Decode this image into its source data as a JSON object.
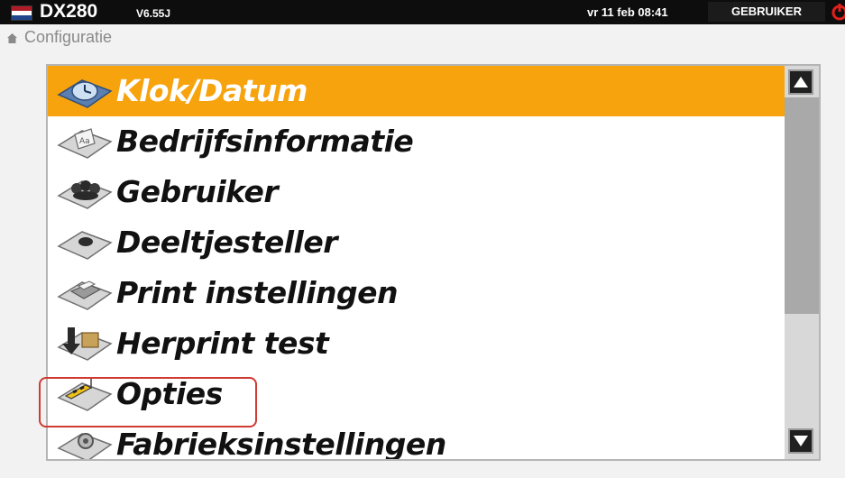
{
  "topbar": {
    "title": "DX280",
    "version": "V6.55J",
    "datetime": "vr 11 feb 08:41",
    "user": "GEBRUIKER"
  },
  "breadcrumb": {
    "label": "Configuratie"
  },
  "menu": {
    "items": [
      {
        "label": "Klok/Datum",
        "icon": "clock-icon",
        "selected": true
      },
      {
        "label": "Bedrijfsinformatie",
        "icon": "company-info-icon",
        "selected": false
      },
      {
        "label": "Gebruiker",
        "icon": "users-icon",
        "selected": false
      },
      {
        "label": "Deeltjesteller",
        "icon": "particle-counter-icon",
        "selected": false
      },
      {
        "label": "Print instellingen",
        "icon": "printer-icon",
        "selected": false
      },
      {
        "label": "Herprint test",
        "icon": "reprint-icon",
        "selected": false
      },
      {
        "label": "Opties",
        "icon": "options-icon",
        "selected": false
      },
      {
        "label": "Fabrieksinstellingen",
        "icon": "factory-settings-icon",
        "selected": false
      }
    ]
  },
  "colors": {
    "selected_bg": "#f7a30e",
    "highlight_border": "#d03a32",
    "topbar_bg": "#0d0d0d"
  }
}
